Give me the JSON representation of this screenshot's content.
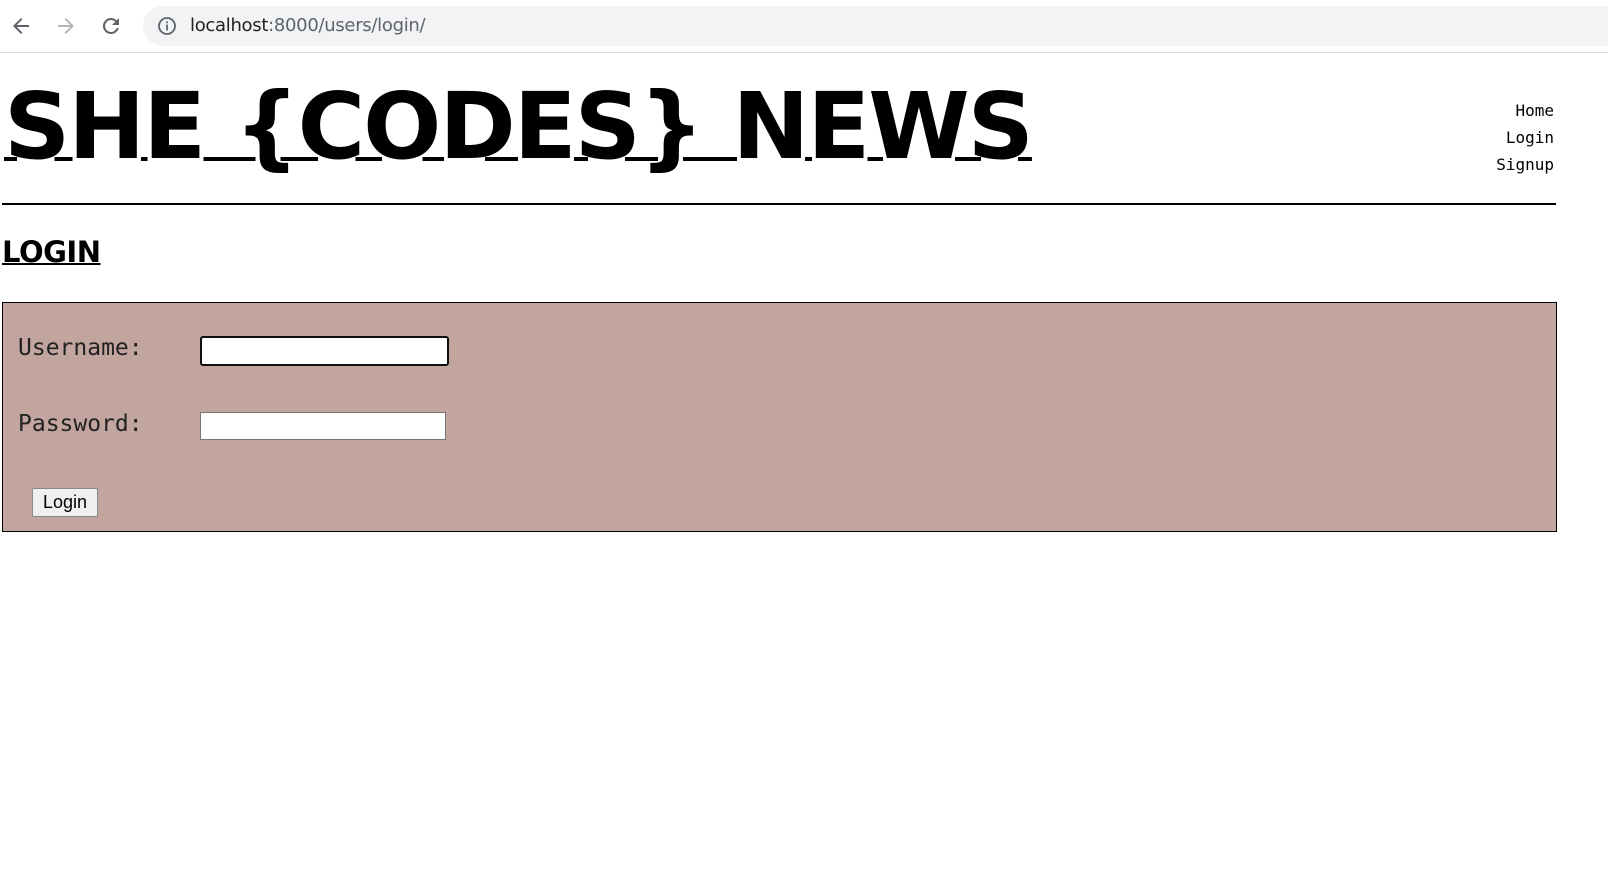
{
  "browser": {
    "url_host": "localhost",
    "url_rest": ":8000/users/login/"
  },
  "site": {
    "title": "SHE {CODES} NEWS",
    "nav": {
      "home": "Home",
      "login": "Login",
      "signup": "Signup"
    }
  },
  "page": {
    "heading": "LOGIN"
  },
  "form": {
    "username_label": "Username:",
    "username_value": "",
    "password_label": "Password:",
    "password_value": "",
    "submit_label": "Login"
  },
  "colors": {
    "form_background": "#c3a59f",
    "text": "#000000"
  },
  "icons": [
    "back-arrow-icon",
    "forward-arrow-icon",
    "reload-icon",
    "info-icon"
  ]
}
